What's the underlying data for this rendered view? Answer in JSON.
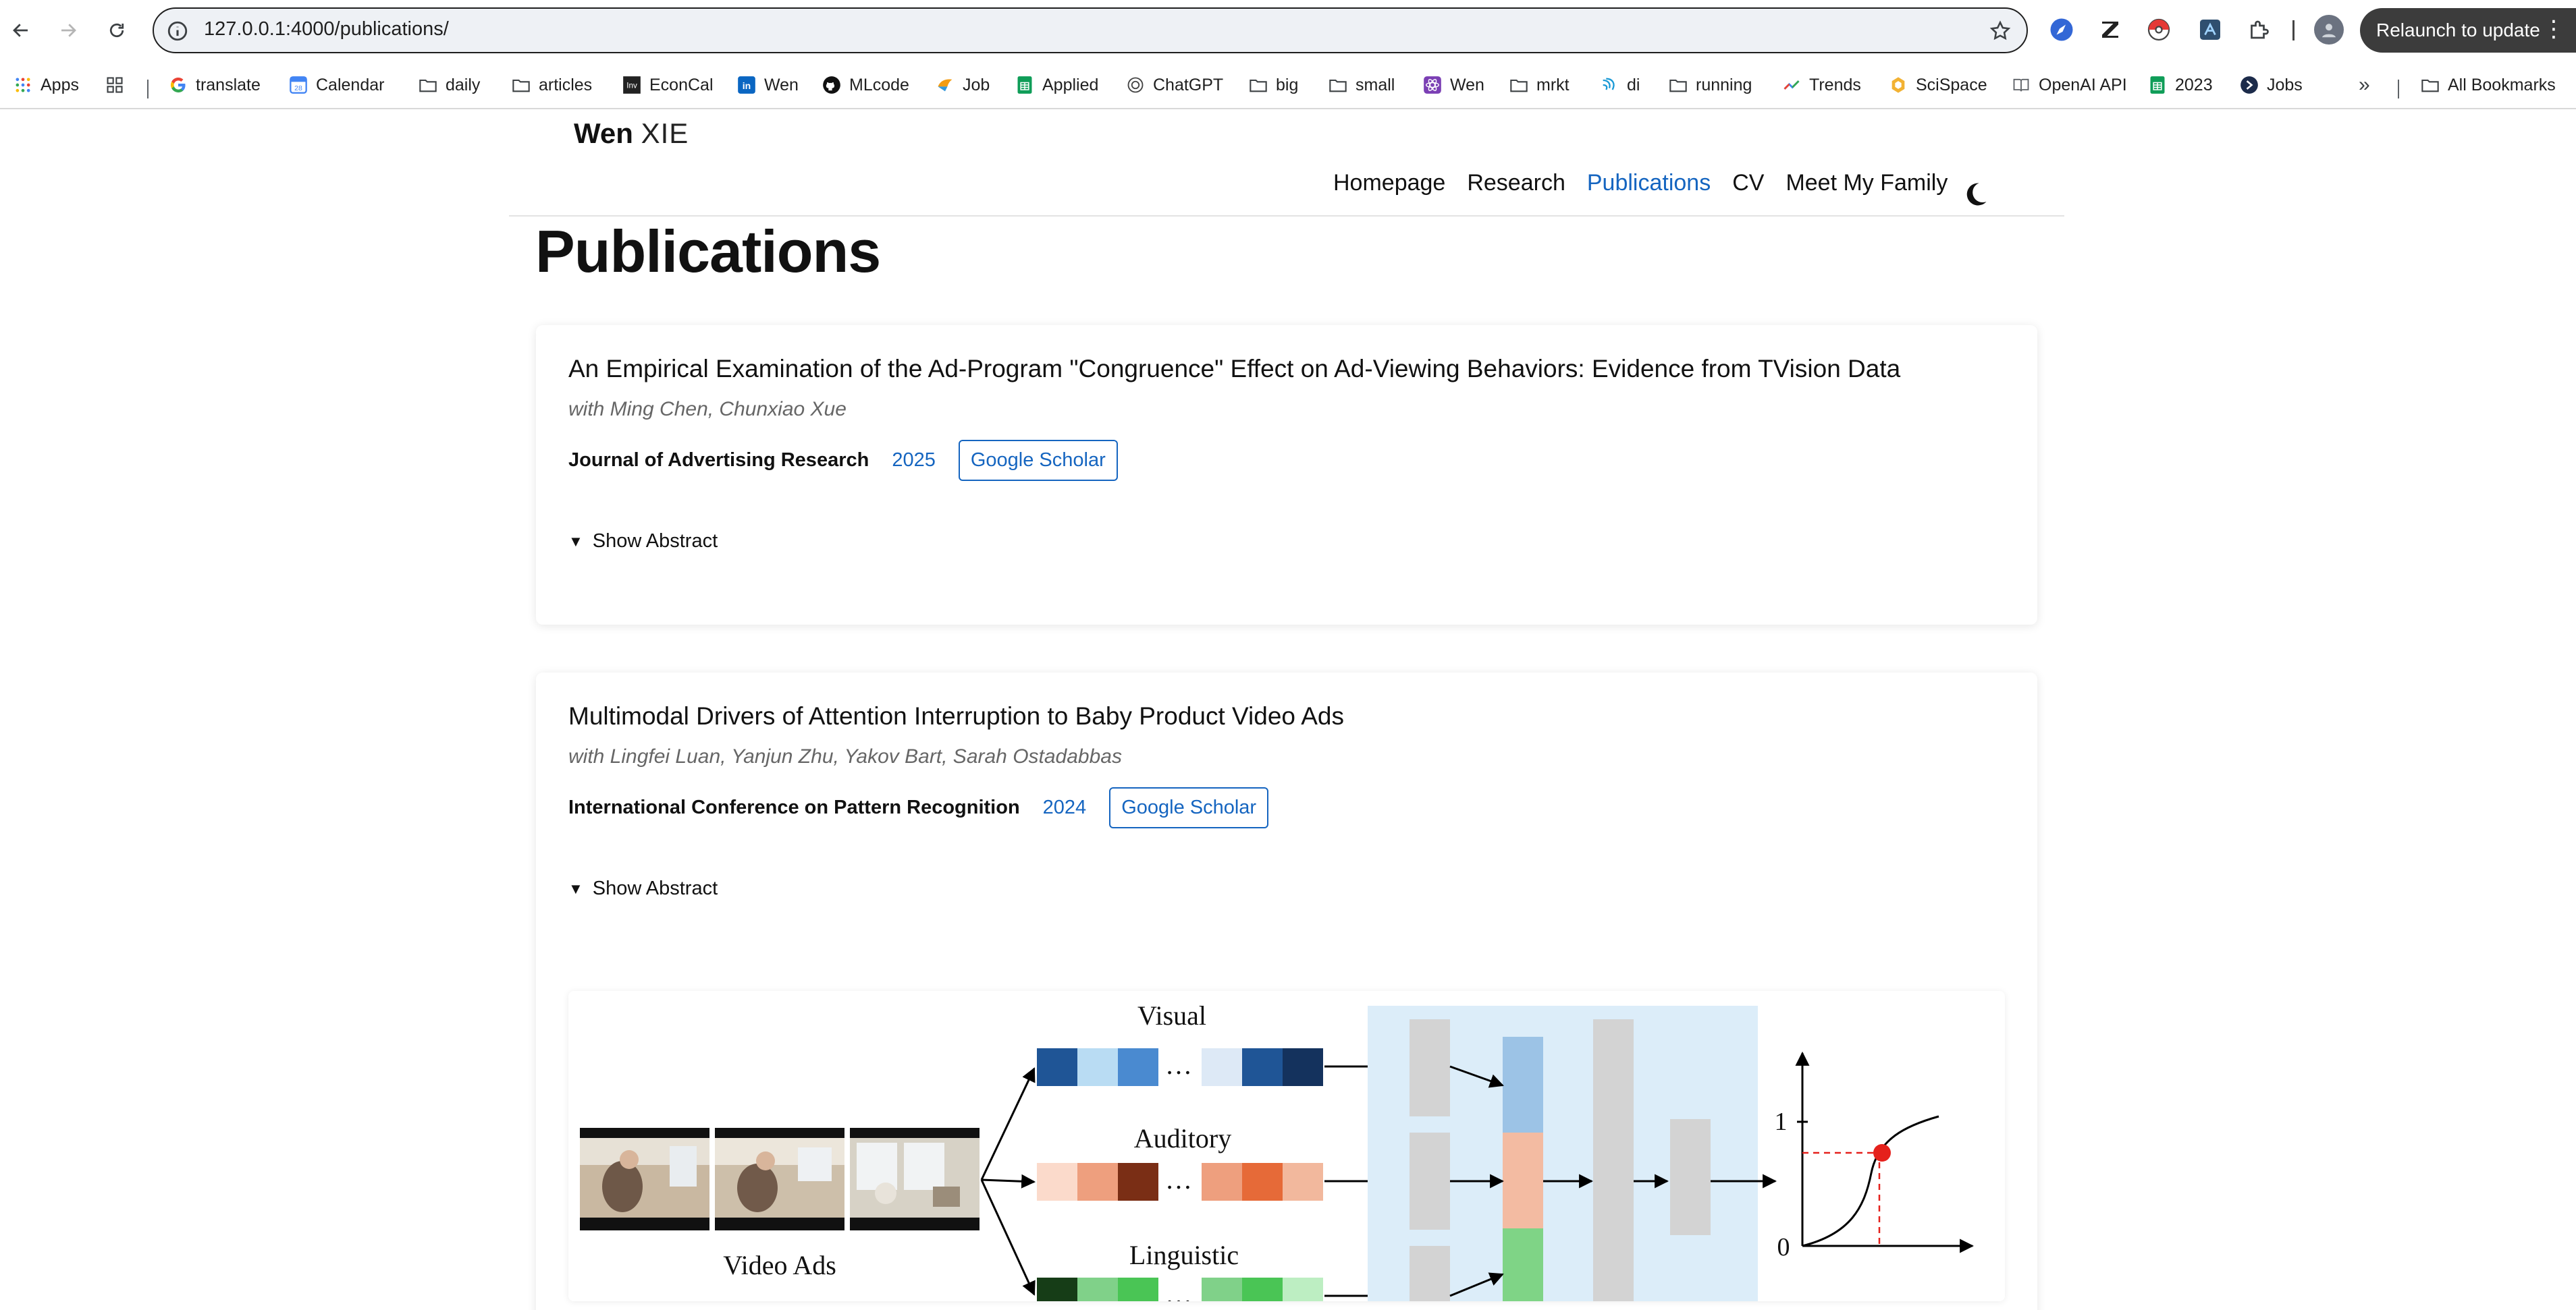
{
  "browser": {
    "url_host": "127.0.0.1",
    "url_rest": ":4000/publications/",
    "relaunch_label": "Relaunch to update"
  },
  "bookmarks": [
    {
      "label": "Apps",
      "icon": "apps-grid-icon"
    },
    {
      "label": "",
      "icon": "tab-groups-icon"
    },
    {
      "label": "translate",
      "icon": "google-icon"
    },
    {
      "label": "Calendar",
      "icon": "calendar-icon"
    },
    {
      "label": "daily",
      "icon": "folder-icon"
    },
    {
      "label": "articles",
      "icon": "folder-icon"
    },
    {
      "label": "EconCal",
      "icon": "investing-icon"
    },
    {
      "label": "Wen",
      "icon": "linkedin-icon"
    },
    {
      "label": "MLcode",
      "icon": "github-icon"
    },
    {
      "label": "Job",
      "icon": "job-icon"
    },
    {
      "label": "Applied",
      "icon": "sheets-icon"
    },
    {
      "label": "ChatGPT",
      "icon": "openai-icon"
    },
    {
      "label": "big",
      "icon": "folder-icon"
    },
    {
      "label": "small",
      "icon": "folder-icon"
    },
    {
      "label": "Wen",
      "icon": "react-icon"
    },
    {
      "label": "mrkt",
      "icon": "folder-icon"
    },
    {
      "label": "di",
      "icon": "di-icon"
    },
    {
      "label": "running",
      "icon": "folder-icon"
    },
    {
      "label": "Trends",
      "icon": "trends-icon"
    },
    {
      "label": "SciSpace",
      "icon": "scispace-icon"
    },
    {
      "label": "OpenAI API",
      "icon": "book-icon"
    },
    {
      "label": "2023",
      "icon": "sheets-icon"
    },
    {
      "label": "Jobs",
      "icon": "jobs-icon"
    },
    {
      "label": "All Bookmarks",
      "icon": "folder-icon"
    }
  ],
  "site": {
    "brand_bold": "Wen",
    "brand_light": "XIE",
    "nav": [
      "Homepage",
      "Research",
      "Publications",
      "CV",
      "Meet My Family"
    ],
    "active_nav": "Publications",
    "page_title": "Publications"
  },
  "publications": [
    {
      "title": "An Empirical Examination of the Ad-Program \"Congruence\" Effect on Ad-Viewing Behaviors: Evidence from TVision Data",
      "authors": "with Ming Chen, Chunxiao Xue",
      "venue": "Journal of Advertising Research",
      "year": "2025",
      "scholar_label": "Google Scholar",
      "abstract_toggle": "Show Abstract"
    },
    {
      "title": "Multimodal Drivers of Attention Interruption to Baby Product Video Ads",
      "authors": "with Lingfei Luan, Yanjun Zhu, Yakov Bart, Sarah Ostadabbas",
      "venue": "International Conference on Pattern Recognition",
      "year": "2024",
      "scholar_label": "Google Scholar",
      "abstract_toggle": "Show Abstract",
      "figure": {
        "video_label": "Video Ads",
        "modalities": [
          "Visual",
          "Auditory",
          "Linguistic"
        ],
        "dots": "…",
        "y_tick_top": "1",
        "y_tick_bottom": "0",
        "colors": {
          "visual": [
            "#1f5596",
            "#b9dcf3",
            "#4a8ad0",
            "#dde9f6",
            "#1f5596",
            "#14325d"
          ],
          "auditory": [
            "#fbdacb",
            "#ee9f7e",
            "#7a2e15",
            "#ee9f7e",
            "#e66a38",
            "#f2b89d"
          ],
          "linguistic": [
            "#163d17",
            "#80d189",
            "#4ac555",
            "#80d189",
            "#4ac555",
            "#bdeec2"
          ],
          "panel": "#dcedf9",
          "block": "#d3d3d3",
          "fused": [
            "#9cc3e6",
            "#f3bba2",
            "#7fd486"
          ],
          "marker": "#e5211c"
        }
      }
    }
  ]
}
